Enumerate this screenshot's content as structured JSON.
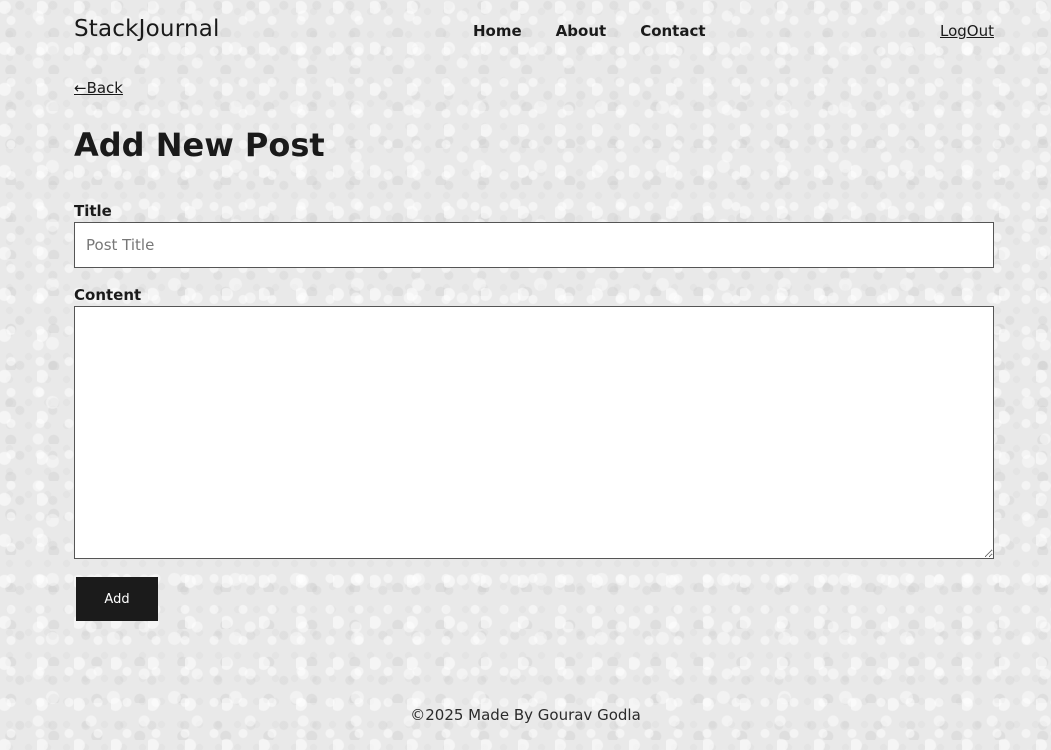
{
  "header": {
    "brand": "StackJournal",
    "nav": [
      {
        "label": "Home"
      },
      {
        "label": "About"
      },
      {
        "label": "Contact"
      }
    ],
    "logout_label": "LogOut"
  },
  "back_link": "←Back",
  "page_title": "Add New Post",
  "form": {
    "title_label": "Title",
    "title_placeholder": "Post Title",
    "title_value": "",
    "content_label": "Content",
    "content_value": "",
    "submit_label": "Add"
  },
  "footer": {
    "text": "©2025 Made By Gourav Godla"
  }
}
